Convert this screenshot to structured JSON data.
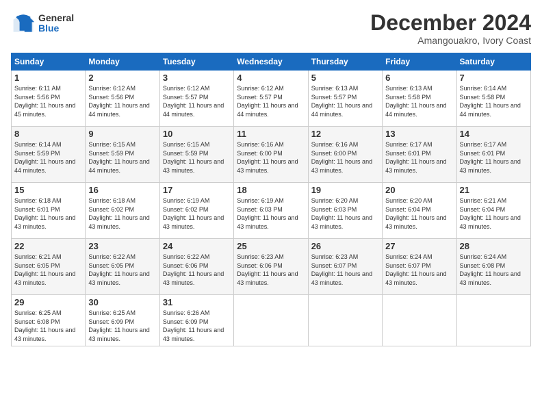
{
  "logo": {
    "general": "General",
    "blue": "Blue"
  },
  "title": "December 2024",
  "subtitle": "Amangouakro, Ivory Coast",
  "weekdays": [
    "Sunday",
    "Monday",
    "Tuesday",
    "Wednesday",
    "Thursday",
    "Friday",
    "Saturday"
  ],
  "weeks": [
    [
      {
        "day": 1,
        "sunrise": "6:11 AM",
        "sunset": "5:56 PM",
        "daylight": "11 hours and 45 minutes."
      },
      {
        "day": 2,
        "sunrise": "6:12 AM",
        "sunset": "5:56 PM",
        "daylight": "11 hours and 44 minutes."
      },
      {
        "day": 3,
        "sunrise": "6:12 AM",
        "sunset": "5:57 PM",
        "daylight": "11 hours and 44 minutes."
      },
      {
        "day": 4,
        "sunrise": "6:12 AM",
        "sunset": "5:57 PM",
        "daylight": "11 hours and 44 minutes."
      },
      {
        "day": 5,
        "sunrise": "6:13 AM",
        "sunset": "5:57 PM",
        "daylight": "11 hours and 44 minutes."
      },
      {
        "day": 6,
        "sunrise": "6:13 AM",
        "sunset": "5:58 PM",
        "daylight": "11 hours and 44 minutes."
      },
      {
        "day": 7,
        "sunrise": "6:14 AM",
        "sunset": "5:58 PM",
        "daylight": "11 hours and 44 minutes."
      }
    ],
    [
      {
        "day": 8,
        "sunrise": "6:14 AM",
        "sunset": "5:59 PM",
        "daylight": "11 hours and 44 minutes."
      },
      {
        "day": 9,
        "sunrise": "6:15 AM",
        "sunset": "5:59 PM",
        "daylight": "11 hours and 44 minutes."
      },
      {
        "day": 10,
        "sunrise": "6:15 AM",
        "sunset": "5:59 PM",
        "daylight": "11 hours and 43 minutes."
      },
      {
        "day": 11,
        "sunrise": "6:16 AM",
        "sunset": "6:00 PM",
        "daylight": "11 hours and 43 minutes."
      },
      {
        "day": 12,
        "sunrise": "6:16 AM",
        "sunset": "6:00 PM",
        "daylight": "11 hours and 43 minutes."
      },
      {
        "day": 13,
        "sunrise": "6:17 AM",
        "sunset": "6:01 PM",
        "daylight": "11 hours and 43 minutes."
      },
      {
        "day": 14,
        "sunrise": "6:17 AM",
        "sunset": "6:01 PM",
        "daylight": "11 hours and 43 minutes."
      }
    ],
    [
      {
        "day": 15,
        "sunrise": "6:18 AM",
        "sunset": "6:01 PM",
        "daylight": "11 hours and 43 minutes."
      },
      {
        "day": 16,
        "sunrise": "6:18 AM",
        "sunset": "6:02 PM",
        "daylight": "11 hours and 43 minutes."
      },
      {
        "day": 17,
        "sunrise": "6:19 AM",
        "sunset": "6:02 PM",
        "daylight": "11 hours and 43 minutes."
      },
      {
        "day": 18,
        "sunrise": "6:19 AM",
        "sunset": "6:03 PM",
        "daylight": "11 hours and 43 minutes."
      },
      {
        "day": 19,
        "sunrise": "6:20 AM",
        "sunset": "6:03 PM",
        "daylight": "11 hours and 43 minutes."
      },
      {
        "day": 20,
        "sunrise": "6:20 AM",
        "sunset": "6:04 PM",
        "daylight": "11 hours and 43 minutes."
      },
      {
        "day": 21,
        "sunrise": "6:21 AM",
        "sunset": "6:04 PM",
        "daylight": "11 hours and 43 minutes."
      }
    ],
    [
      {
        "day": 22,
        "sunrise": "6:21 AM",
        "sunset": "6:05 PM",
        "daylight": "11 hours and 43 minutes."
      },
      {
        "day": 23,
        "sunrise": "6:22 AM",
        "sunset": "6:05 PM",
        "daylight": "11 hours and 43 minutes."
      },
      {
        "day": 24,
        "sunrise": "6:22 AM",
        "sunset": "6:06 PM",
        "daylight": "11 hours and 43 minutes."
      },
      {
        "day": 25,
        "sunrise": "6:23 AM",
        "sunset": "6:06 PM",
        "daylight": "11 hours and 43 minutes."
      },
      {
        "day": 26,
        "sunrise": "6:23 AM",
        "sunset": "6:07 PM",
        "daylight": "11 hours and 43 minutes."
      },
      {
        "day": 27,
        "sunrise": "6:24 AM",
        "sunset": "6:07 PM",
        "daylight": "11 hours and 43 minutes."
      },
      {
        "day": 28,
        "sunrise": "6:24 AM",
        "sunset": "6:08 PM",
        "daylight": "11 hours and 43 minutes."
      }
    ],
    [
      {
        "day": 29,
        "sunrise": "6:25 AM",
        "sunset": "6:08 PM",
        "daylight": "11 hours and 43 minutes."
      },
      {
        "day": 30,
        "sunrise": "6:25 AM",
        "sunset": "6:09 PM",
        "daylight": "11 hours and 43 minutes."
      },
      {
        "day": 31,
        "sunrise": "6:26 AM",
        "sunset": "6:09 PM",
        "daylight": "11 hours and 43 minutes."
      },
      null,
      null,
      null,
      null
    ]
  ]
}
